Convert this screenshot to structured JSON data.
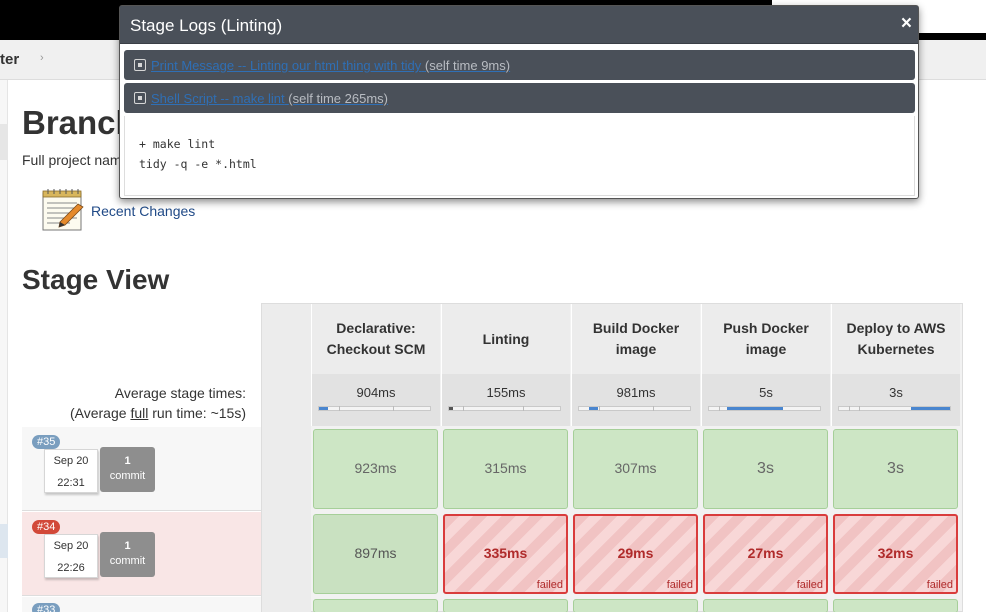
{
  "breadcrumb": {
    "last": "ter",
    "separator": "›"
  },
  "page": {
    "title": "Branch",
    "full_project_name": "Full project nam",
    "recent_changes": "Recent Changes",
    "stage_view_title": "Stage View"
  },
  "stage_view": {
    "avg_label": "Average stage times:",
    "avg_run_prefix": "(Average ",
    "avg_run_full": "full",
    "avg_run_suffix": " run time: ~15s)",
    "stages": [
      {
        "name": "Declarative: Checkout SCM",
        "avg": "904ms",
        "progress": 0.08
      },
      {
        "name": "Linting",
        "avg": "155ms",
        "progress": 0.02
      },
      {
        "name": "Build Docker image",
        "avg": "981ms",
        "progress": 0.08
      },
      {
        "name": "Push Docker image",
        "avg": "5s",
        "progress": 0.5
      },
      {
        "name": "Deploy to AWS Kubernetes",
        "avg": "3s",
        "progress": 0.35
      }
    ],
    "runs": [
      {
        "number": "#35",
        "status": "success",
        "date": "Sep 20",
        "time": "22:31",
        "commits": "1",
        "commit_label": "commit",
        "cells": [
          "923ms",
          "315ms",
          "307ms",
          "3s",
          "3s"
        ]
      },
      {
        "number": "#34",
        "status": "failed",
        "date": "Sep 20",
        "time": "22:26",
        "commits": "1",
        "commit_label": "commit",
        "cells": [
          "897ms",
          "335ms",
          "29ms",
          "27ms",
          "32ms"
        ],
        "failed_label": "failed"
      },
      {
        "number": "#33"
      }
    ]
  },
  "modal": {
    "title": "Stage Logs (Linting)",
    "close": "×",
    "steps": [
      {
        "name": "Print Message -- Linting our html thing with tidy",
        "time": "(self time 9ms)"
      },
      {
        "name": "Shell Script -- make lint",
        "time": "(self time 265ms)"
      }
    ],
    "console_lines": [
      "+ make lint",
      "tidy -q -e *.html"
    ]
  },
  "colors": {
    "success_cell": "#cde6c5",
    "failed_border": "#d93c3c",
    "modal_header": "#4a5059",
    "link": "#204a87",
    "progress_fill": "#4a86cf"
  }
}
